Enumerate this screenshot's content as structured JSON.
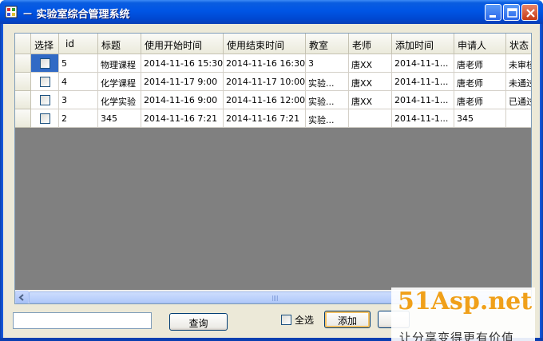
{
  "window": {
    "title": "－ 实验室综合管理系统",
    "controls": {
      "minimize": "minimize-icon",
      "maximize": "maximize-icon",
      "close": "close-icon"
    }
  },
  "grid": {
    "columns": [
      "选择",
      "id",
      "标题",
      "使用开始时间",
      "使用结束时间",
      "教室",
      "老师",
      "添加时间",
      "申请人",
      "状态"
    ],
    "rows": [
      {
        "id": "5",
        "title": "物理课程",
        "start": "2014-11-16 15:30",
        "end": "2014-11-16 16:30",
        "room": "3",
        "teacher": "唐XX",
        "added": "2014-11-1...",
        "applicant": "唐老师",
        "status": "未审核"
      },
      {
        "id": "4",
        "title": "化学课程",
        "start": "2014-11-17 9:00",
        "end": "2014-11-17 10:00",
        "room": "实验...",
        "teacher": "唐XX",
        "added": "2014-11-1...",
        "applicant": "唐老师",
        "status": "未通过"
      },
      {
        "id": "3",
        "title": "化学实验",
        "start": "2014-11-16 9:00",
        "end": "2014-11-16 12:00",
        "room": "实验...",
        "teacher": "唐XX",
        "added": "2014-11-1...",
        "applicant": "唐老师",
        "status": "已通过"
      },
      {
        "id": "2",
        "title": "345",
        "start": "2014-11-16 7:21",
        "end": "2014-11-16 7:21",
        "room": "实验...",
        "teacher": "",
        "added": "2014-11-1...",
        "applicant": "345",
        "status": ""
      }
    ],
    "scroll_grip": "III"
  },
  "toolbar": {
    "search_value": "",
    "query_label": "查询",
    "select_all_label": "全选",
    "add_label": "添加"
  },
  "watermark": {
    "brand": "51Asp.net",
    "slogan": "让分享变得更有价值"
  },
  "colors": {
    "title_bar": "#0055e5",
    "selection": "#316ac5",
    "grid_background": "#808080",
    "brand_orange": "#f0a01a"
  }
}
